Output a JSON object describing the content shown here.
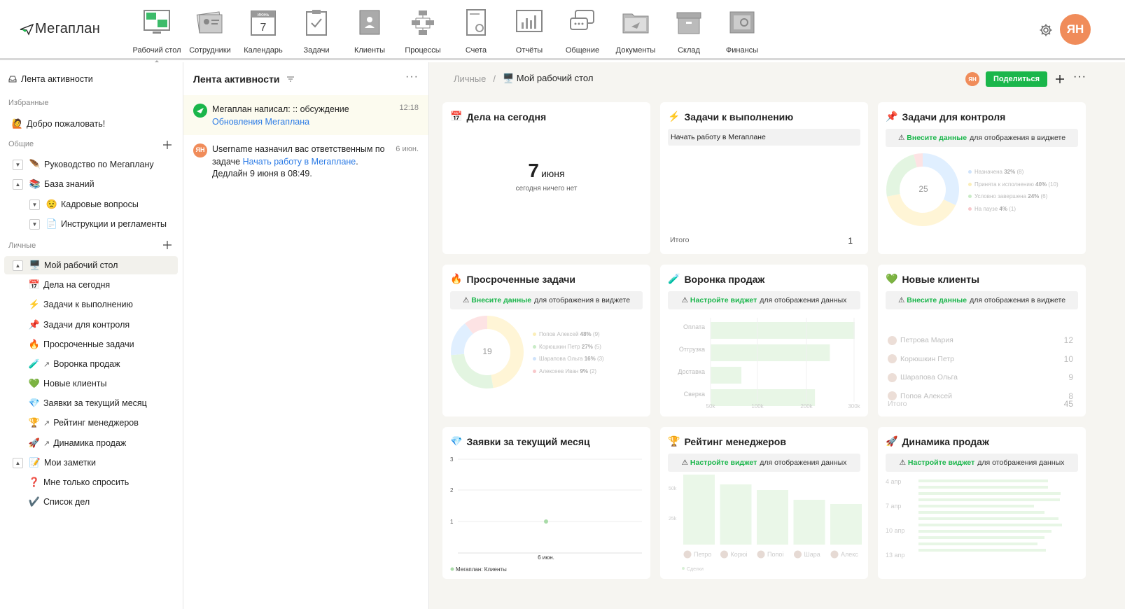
{
  "app": {
    "logo_text": "Мегаплан",
    "avatar_initials": "ЯН",
    "nav": [
      {
        "label": "Рабочий стол",
        "icon": "desktop-icon"
      },
      {
        "label": "Сотрудники",
        "icon": "employees-icon"
      },
      {
        "label": "Календарь",
        "icon": "calendar-icon",
        "sub": "июнь",
        "num": "7"
      },
      {
        "label": "Задачи",
        "icon": "tasks-icon"
      },
      {
        "label": "Клиенты",
        "icon": "clients-icon"
      },
      {
        "label": "Процессы",
        "icon": "processes-icon"
      },
      {
        "label": "Счета",
        "icon": "invoices-icon"
      },
      {
        "label": "Отчёты",
        "icon": "reports-icon"
      },
      {
        "label": "Общение",
        "icon": "chat-icon"
      },
      {
        "label": "Документы",
        "icon": "documents-icon"
      },
      {
        "label": "Склад",
        "icon": "warehouse-icon"
      },
      {
        "label": "Финансы",
        "icon": "finance-icon"
      }
    ]
  },
  "sidebar": {
    "activity": "Лента активности",
    "favorites_title": "Избранные",
    "welcome": "Добро пожаловать!",
    "common_title": "Общие",
    "common": [
      "Руководство по Мегаплану",
      "База знаний",
      "Кадровые вопросы",
      "Инструкции и регламенты"
    ],
    "personal_title": "Личные",
    "personal": [
      "Мой рабочий стол",
      "Дела на сегодня",
      "Задачи к выполнению",
      "Задачи для контроля",
      "Просроченные задачи",
      "Воронка продаж",
      "Новые клиенты",
      "Заявки за текущий месяц",
      "Рейтинг менеджеров",
      "Динамика продаж",
      "Мои заметки",
      "Мне только спросить",
      "Список дел"
    ]
  },
  "feed": {
    "title": "Лента активности",
    "items": [
      {
        "line1": "Мегаплан написал: :: обсуждение",
        "link": "Обновления Мегаплана",
        "time": "12:18"
      },
      {
        "pre": "Username назначил вас ответственным по задаче ",
        "link": "Начать работу в Мегаплане",
        "post": ". Дедлайн 9 июня в 08:49.",
        "time": "6 июн.",
        "avatar": "ЯН"
      }
    ]
  },
  "main": {
    "breadcrumb_root": "Личные",
    "breadcrumb_sep": "/",
    "breadcrumb_current": "Мой рабочий стол",
    "share": "Поделиться",
    "avatar": "ЯН"
  },
  "widgets": {
    "today": {
      "title": "Дела на сегодня",
      "day": "7",
      "month": "июня",
      "note": "сегодня ничего нет"
    },
    "todo": {
      "title": "Задачи к выполнению",
      "item": "Начать работу в Мегаплане",
      "total_label": "Итого",
      "total": "1"
    },
    "control": {
      "title": "Задачи для контроля",
      "notice_link": "Внесите данные",
      "notice_rest": "для отображения в виджете",
      "center": "25",
      "legend": [
        {
          "name": "Назначена",
          "val": "32%",
          "cnt": "(8)"
        },
        {
          "name": "Принята к исполнению",
          "val": "40%",
          "cnt": "(10)"
        },
        {
          "name": "Условно завершена",
          "val": "24%",
          "cnt": "(6)"
        },
        {
          "name": "На паузе",
          "val": "4%",
          "cnt": "(1)"
        }
      ]
    },
    "overdue": {
      "title": "Просроченные задачи",
      "notice_link": "Внесите данные",
      "notice_rest": "для отображения в виджете",
      "center": "19",
      "legend": [
        {
          "name": "Попов Алексей",
          "val": "48%",
          "cnt": "(9)"
        },
        {
          "name": "Корюшкин Петр",
          "val": "27%",
          "cnt": "(5)"
        },
        {
          "name": "Шарапова Ольга",
          "val": "16%",
          "cnt": "(3)"
        },
        {
          "name": "Алексеев Иван",
          "val": "9%",
          "cnt": "(2)"
        }
      ]
    },
    "funnel": {
      "title": "Воронка продаж",
      "notice_link": "Настройте виджет",
      "notice_rest": "для отображения данных",
      "stages": [
        {
          "name": "Оплата",
          "value": 290000
        },
        {
          "name": "Отгрузка",
          "value": 240000
        },
        {
          "name": "Доставка",
          "value": 62000
        },
        {
          "name": "Сверка",
          "value": 210000
        }
      ],
      "ticks": [
        "50k",
        "100k",
        "200k",
        "300k"
      ]
    },
    "clients": {
      "title": "Новые клиенты",
      "notice_link": "Внесите данные",
      "notice_rest": "для отображения в виджете",
      "rows": [
        {
          "name": "Петрова Мария",
          "val": "12"
        },
        {
          "name": "Корюшкин Петр",
          "val": "10"
        },
        {
          "name": "Шарапова Ольга",
          "val": "9"
        },
        {
          "name": "Попов Алексей",
          "val": "8"
        }
      ],
      "total_label": "Итого",
      "total": "45"
    },
    "requests": {
      "title": "Заявки за текущий месяц",
      "yticks": [
        "3",
        "2",
        "1"
      ],
      "xlabel": "6 июн.",
      "legend": "Мегаплан: Клиенты"
    },
    "rating": {
      "title": "Рейтинг менеджеров",
      "notice_link": "Настройте виджет",
      "notice_rest": "для отображения данных",
      "yticks": [
        "50k",
        "25k"
      ],
      "names": [
        "Петро",
        "Корюі",
        "Попоі",
        "Шара",
        "Алекс"
      ],
      "legend": "Сделки"
    },
    "dynamics": {
      "title": "Динамика продаж",
      "notice_link": "Настройте виджет",
      "notice_rest": "для отображения данных",
      "dates": [
        "4 апр",
        "7 апр",
        "10 апр",
        "13 апр"
      ]
    }
  },
  "chart_data": [
    {
      "type": "bar",
      "title": "Воронка продаж",
      "categories": [
        "Оплата",
        "Отгрузка",
        "Доставка",
        "Сверка"
      ],
      "values": [
        290000,
        240000,
        62000,
        210000
      ]
    },
    {
      "type": "pie",
      "title": "Задачи для контроля",
      "categories": [
        "Назначена",
        "Принята к исполнению",
        "Условно завершена",
        "На паузе"
      ],
      "values": [
        8,
        10,
        6,
        1
      ]
    },
    {
      "type": "pie",
      "title": "Просроченные задачи",
      "categories": [
        "Попов Алексей",
        "Корюшкин Петр",
        "Шарапова Ольга",
        "Алексеев Иван"
      ],
      "values": [
        9,
        5,
        3,
        2
      ]
    },
    {
      "type": "line",
      "title": "Заявки за текущий месяц",
      "x": [
        "6 июн."
      ],
      "series": [
        {
          "name": "Мегаплан: Клиенты",
          "values": [
            1
          ]
        }
      ],
      "ylim": [
        0,
        3
      ]
    }
  ]
}
